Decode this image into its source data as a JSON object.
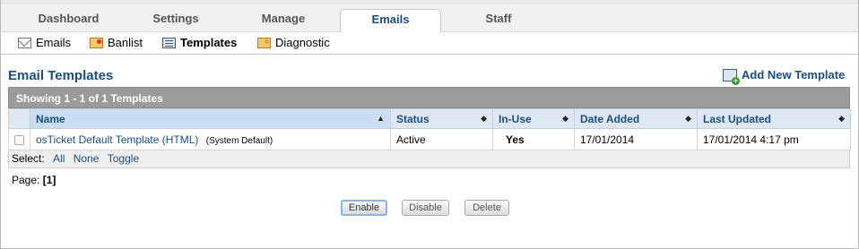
{
  "nav": {
    "tabs": [
      {
        "label": "Dashboard"
      },
      {
        "label": "Settings"
      },
      {
        "label": "Manage"
      },
      {
        "label": "Emails"
      },
      {
        "label": "Staff"
      }
    ]
  },
  "subnav": {
    "items": [
      {
        "label": "Emails",
        "icon": "envelope-icon"
      },
      {
        "label": "Banlist",
        "icon": "banlist-icon"
      },
      {
        "label": "Templates",
        "icon": "template-icon"
      },
      {
        "label": "Diagnostic",
        "icon": "diagnostic-icon"
      }
    ]
  },
  "page": {
    "title": "Email Templates",
    "add_new": "Add New Template"
  },
  "table": {
    "showing": "Showing  1 - 1 of 1 Templates",
    "columns": [
      "Name",
      "Status",
      "In-Use",
      "Date Added",
      "Last Updated"
    ],
    "rows": [
      {
        "name": "osTicket Default Template (HTML)",
        "note": "(System Default)",
        "status": "Active",
        "in_use": "Yes",
        "date_added": "17/01/2014",
        "last_updated": "17/01/2014 4:17 pm"
      }
    ]
  },
  "select": {
    "label": "Select:",
    "all": "All",
    "none": "None",
    "toggle": "Toggle"
  },
  "paging": {
    "label": "Page:",
    "current": "[1]"
  },
  "actions": {
    "enable": "Enable",
    "disable": "Disable",
    "delete": "Delete"
  }
}
